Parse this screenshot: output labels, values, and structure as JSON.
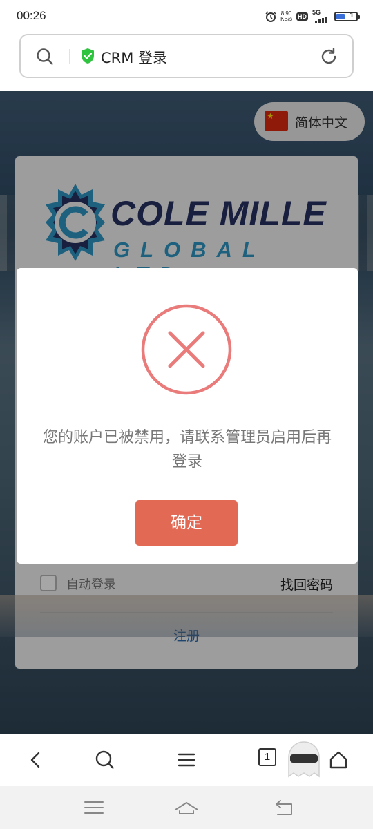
{
  "status_bar": {
    "time": "00:26",
    "net_speed_value": "8.90",
    "net_speed_unit": "KB/s",
    "hd_label": "HD",
    "network_label": "5G",
    "battery_level": "1",
    "icons": [
      "alarm-icon",
      "signal-icon",
      "battery-icon"
    ]
  },
  "address_bar": {
    "title": "CRM 登录",
    "secure_icon": "shield-check-icon",
    "shield_color": "#2ec43f"
  },
  "page": {
    "language_button": {
      "label": "简体中文",
      "flag": "cn-flag-icon"
    },
    "logo": {
      "line1": "COLE MILLE",
      "line2": "GLOBAL LTD"
    },
    "remember_label": "自动登录",
    "forgot_label": "找回密码",
    "register_label": "注册"
  },
  "dialog": {
    "icon": "error-x-icon",
    "icon_color": "#ea7b7b",
    "message": "您的账户已被禁用，请联系管理员启用后再登录",
    "confirm_label": "确定",
    "confirm_color": "#e26a55"
  },
  "browser_toolbar": {
    "tab_count": "1",
    "icons": [
      "back-icon",
      "search-icon",
      "menu-icon",
      "tabs-icon",
      "ghost-icon",
      "home-icon"
    ]
  },
  "system_nav": {
    "icons": [
      "recents-icon",
      "home-icon",
      "back-icon"
    ]
  }
}
